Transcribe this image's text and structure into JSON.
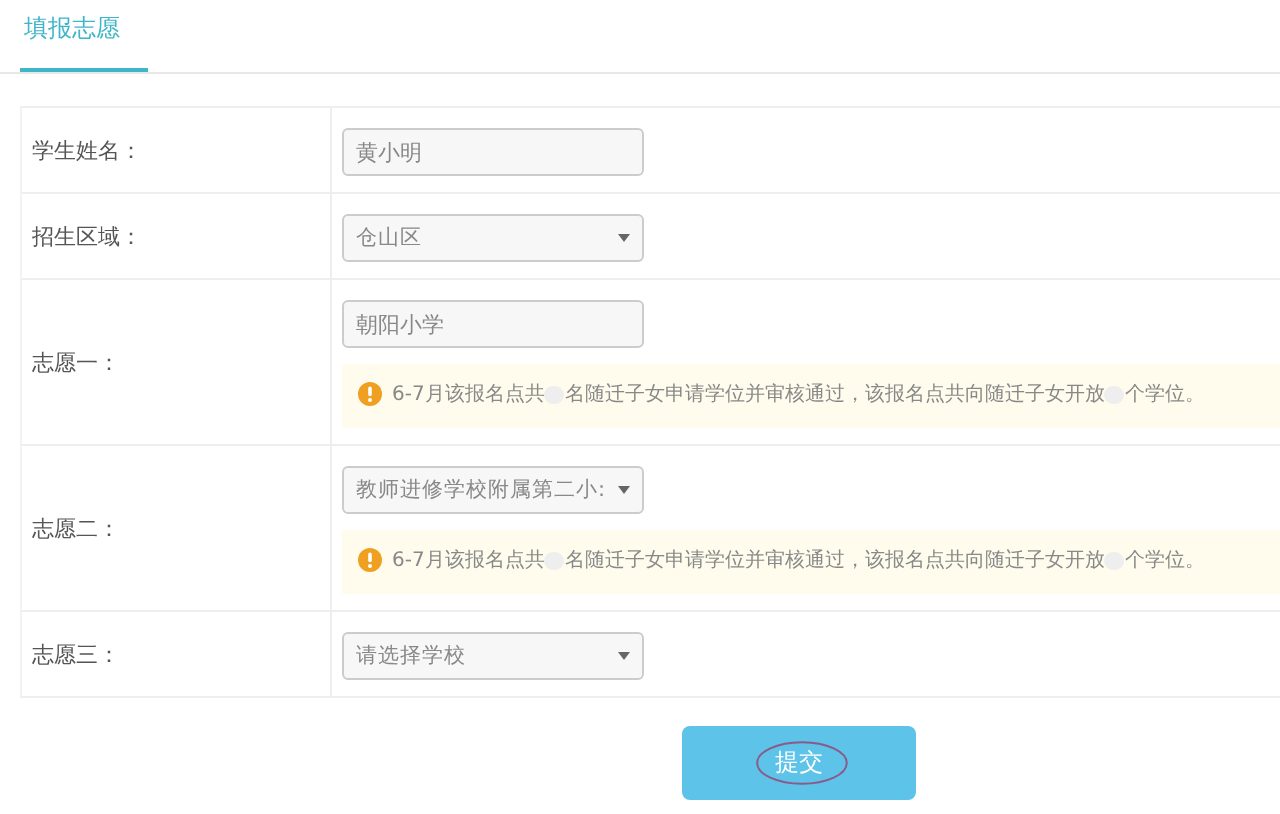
{
  "tabs": [
    {
      "label": "填报志愿",
      "selected": true
    }
  ],
  "form": {
    "rows": [
      {
        "label": "学生姓名：",
        "kind": "input",
        "value": "黄小明"
      },
      {
        "label": "招生区域：",
        "kind": "select",
        "value": "仓山区"
      },
      {
        "label": "志愿一：",
        "kind": "input",
        "value": "朝阳小学",
        "notice": [
          "6-7月该报名点共",
          "名随迁子女申请学位并审核通过，该报名点共向随迁子女开放",
          "个学位。"
        ]
      },
      {
        "label": "志愿二：",
        "kind": "select",
        "value": "教师进修学校附属第二小:",
        "notice": [
          "6-7月该报名点共",
          "名随迁子女申请学位并审核通过，该报名点共向随迁子女开放",
          "个学位。"
        ]
      },
      {
        "label": "志愿三：",
        "kind": "select",
        "placeholder": "请选择学校"
      }
    ]
  },
  "submit": {
    "label": "提交",
    "circled": true
  }
}
